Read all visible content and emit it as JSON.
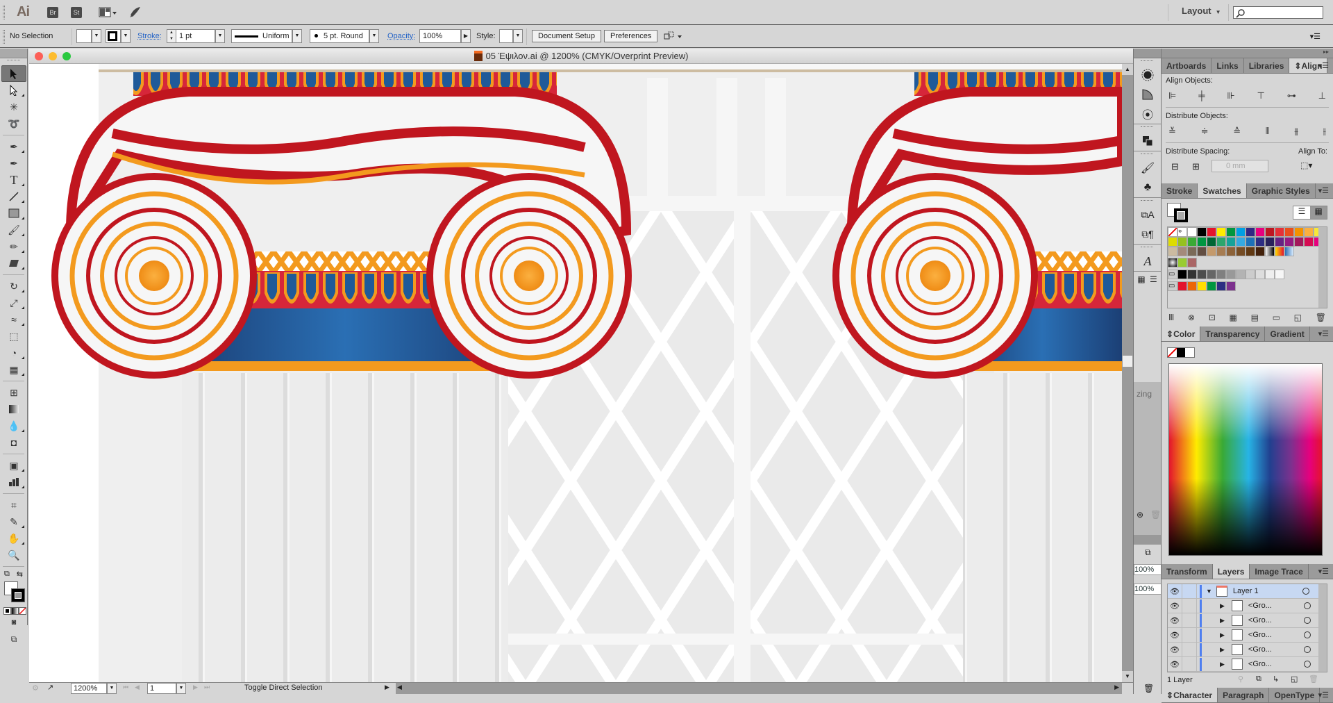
{
  "appbar": {
    "logo": "Ai",
    "bridge_label": "Br",
    "stock_label": "St",
    "workspace_label": "Layout",
    "search_placeholder": ""
  },
  "controlbar": {
    "selection_status": "No Selection",
    "stroke_label": "Stroke:",
    "stroke_weight": "1 pt",
    "profile_label": "Uniform",
    "brush_label": "5 pt. Round",
    "opacity_label": "Opacity:",
    "opacity_value": "100%",
    "style_label": "Style:",
    "document_setup_label": "Document Setup",
    "preferences_label": "Preferences"
  },
  "document": {
    "title": "05 Έψιλον.ai @ 1200% (CMYK/Overprint Preview)",
    "zoom_value": "1200%",
    "artboard_number": "1",
    "status_text": "Toggle Direct Selection"
  },
  "tools": [
    "selection-tool",
    "direct-selection-tool",
    "magic-wand-tool",
    "lasso-tool",
    "pen-tool",
    "curvature-tool",
    "type-tool",
    "line-segment-tool",
    "rectangle-tool",
    "paintbrush-tool",
    "pencil-tool",
    "eraser-tool",
    "rotate-tool",
    "scale-tool",
    "width-tool",
    "free-transform-tool",
    "shape-builder-tool",
    "perspective-grid-tool",
    "mesh-tool",
    "gradient-tool",
    "eyedropper-tool",
    "blend-tool",
    "symbol-sprayer-tool",
    "column-graph-tool",
    "artboard-tool",
    "slice-tool",
    "hand-tool",
    "zoom-tool"
  ],
  "align_panel": {
    "tabs": [
      "Artboards",
      "Links",
      "Libraries",
      "Align"
    ],
    "active_tab": "Align",
    "align_objects_label": "Align Objects:",
    "distribute_objects_label": "Distribute Objects:",
    "distribute_spacing_label": "Distribute Spacing:",
    "align_to_label": "Align To:",
    "spacing_value": "0 mm"
  },
  "swatches_panel": {
    "tabs": [
      "Stroke",
      "Swatches",
      "Graphic Styles"
    ],
    "active_tab": "Swatches",
    "row1": [
      "#ffffff",
      "#000000",
      "#e3142d",
      "#ffec00",
      "#00963f",
      "#009fe3",
      "#312783",
      "#e6007e",
      "#be1622",
      "#e53037",
      "#e94e1b",
      "#f39200",
      "#fbb040"
    ],
    "row2": [
      "#f8e838",
      "#dedc00",
      "#95c11f",
      "#3aaa35",
      "#009640",
      "#006633",
      "#2ca66c",
      "#16a299",
      "#36a9e1",
      "#1d71b8",
      "#2d2e83",
      "#29235c",
      "#662483",
      "#951b81",
      "#a3195b"
    ],
    "row3": [
      "#d60b52",
      "#e6007e",
      "#cbbba0",
      "#a48a7b",
      "#7b6a58",
      "#634e42",
      "#c49a6c",
      "#a67c52",
      "#8c6239",
      "#754c24",
      "#603913",
      "#42210b"
    ],
    "grays": [
      "#000000",
      "#333333",
      "#4d4d4d",
      "#666666",
      "#808080",
      "#999999",
      "#b3b3b3",
      "#cccccc",
      "#dddddd",
      "#eeeeee",
      "#f6f6f6"
    ],
    "brights": [
      "#e3142d",
      "#ec6608",
      "#ffde00",
      "#009640",
      "#2d2e83",
      "#7d318e"
    ]
  },
  "color_panel": {
    "tabs": [
      "Color",
      "Transparency",
      "Gradient"
    ],
    "active_tab": "Color"
  },
  "layers_panel": {
    "tabs": [
      "Transform",
      "Layers",
      "Image Trace"
    ],
    "active_tab": "Layers",
    "layer_name": "Layer 1",
    "sublayers": [
      "<Gro...",
      "<Gro...",
      "<Gro...",
      "<Gro...",
      "<Gro..."
    ],
    "count_label": "1 Layer"
  },
  "character_panel": {
    "tabs": [
      "Character",
      "Paragraph",
      "OpenType"
    ],
    "active_tab": "Character"
  },
  "collapsed_panel": {
    "partial_label": "zing",
    "opacity_1": "100%",
    "opacity_2": "100%"
  },
  "colors": {
    "accent_link": "#2463c6",
    "scroll_red": "#c0161f",
    "scroll_orange": "#f39a1e",
    "capital_blue": "#1f5a99",
    "column_gray": "#e6e6e6"
  }
}
